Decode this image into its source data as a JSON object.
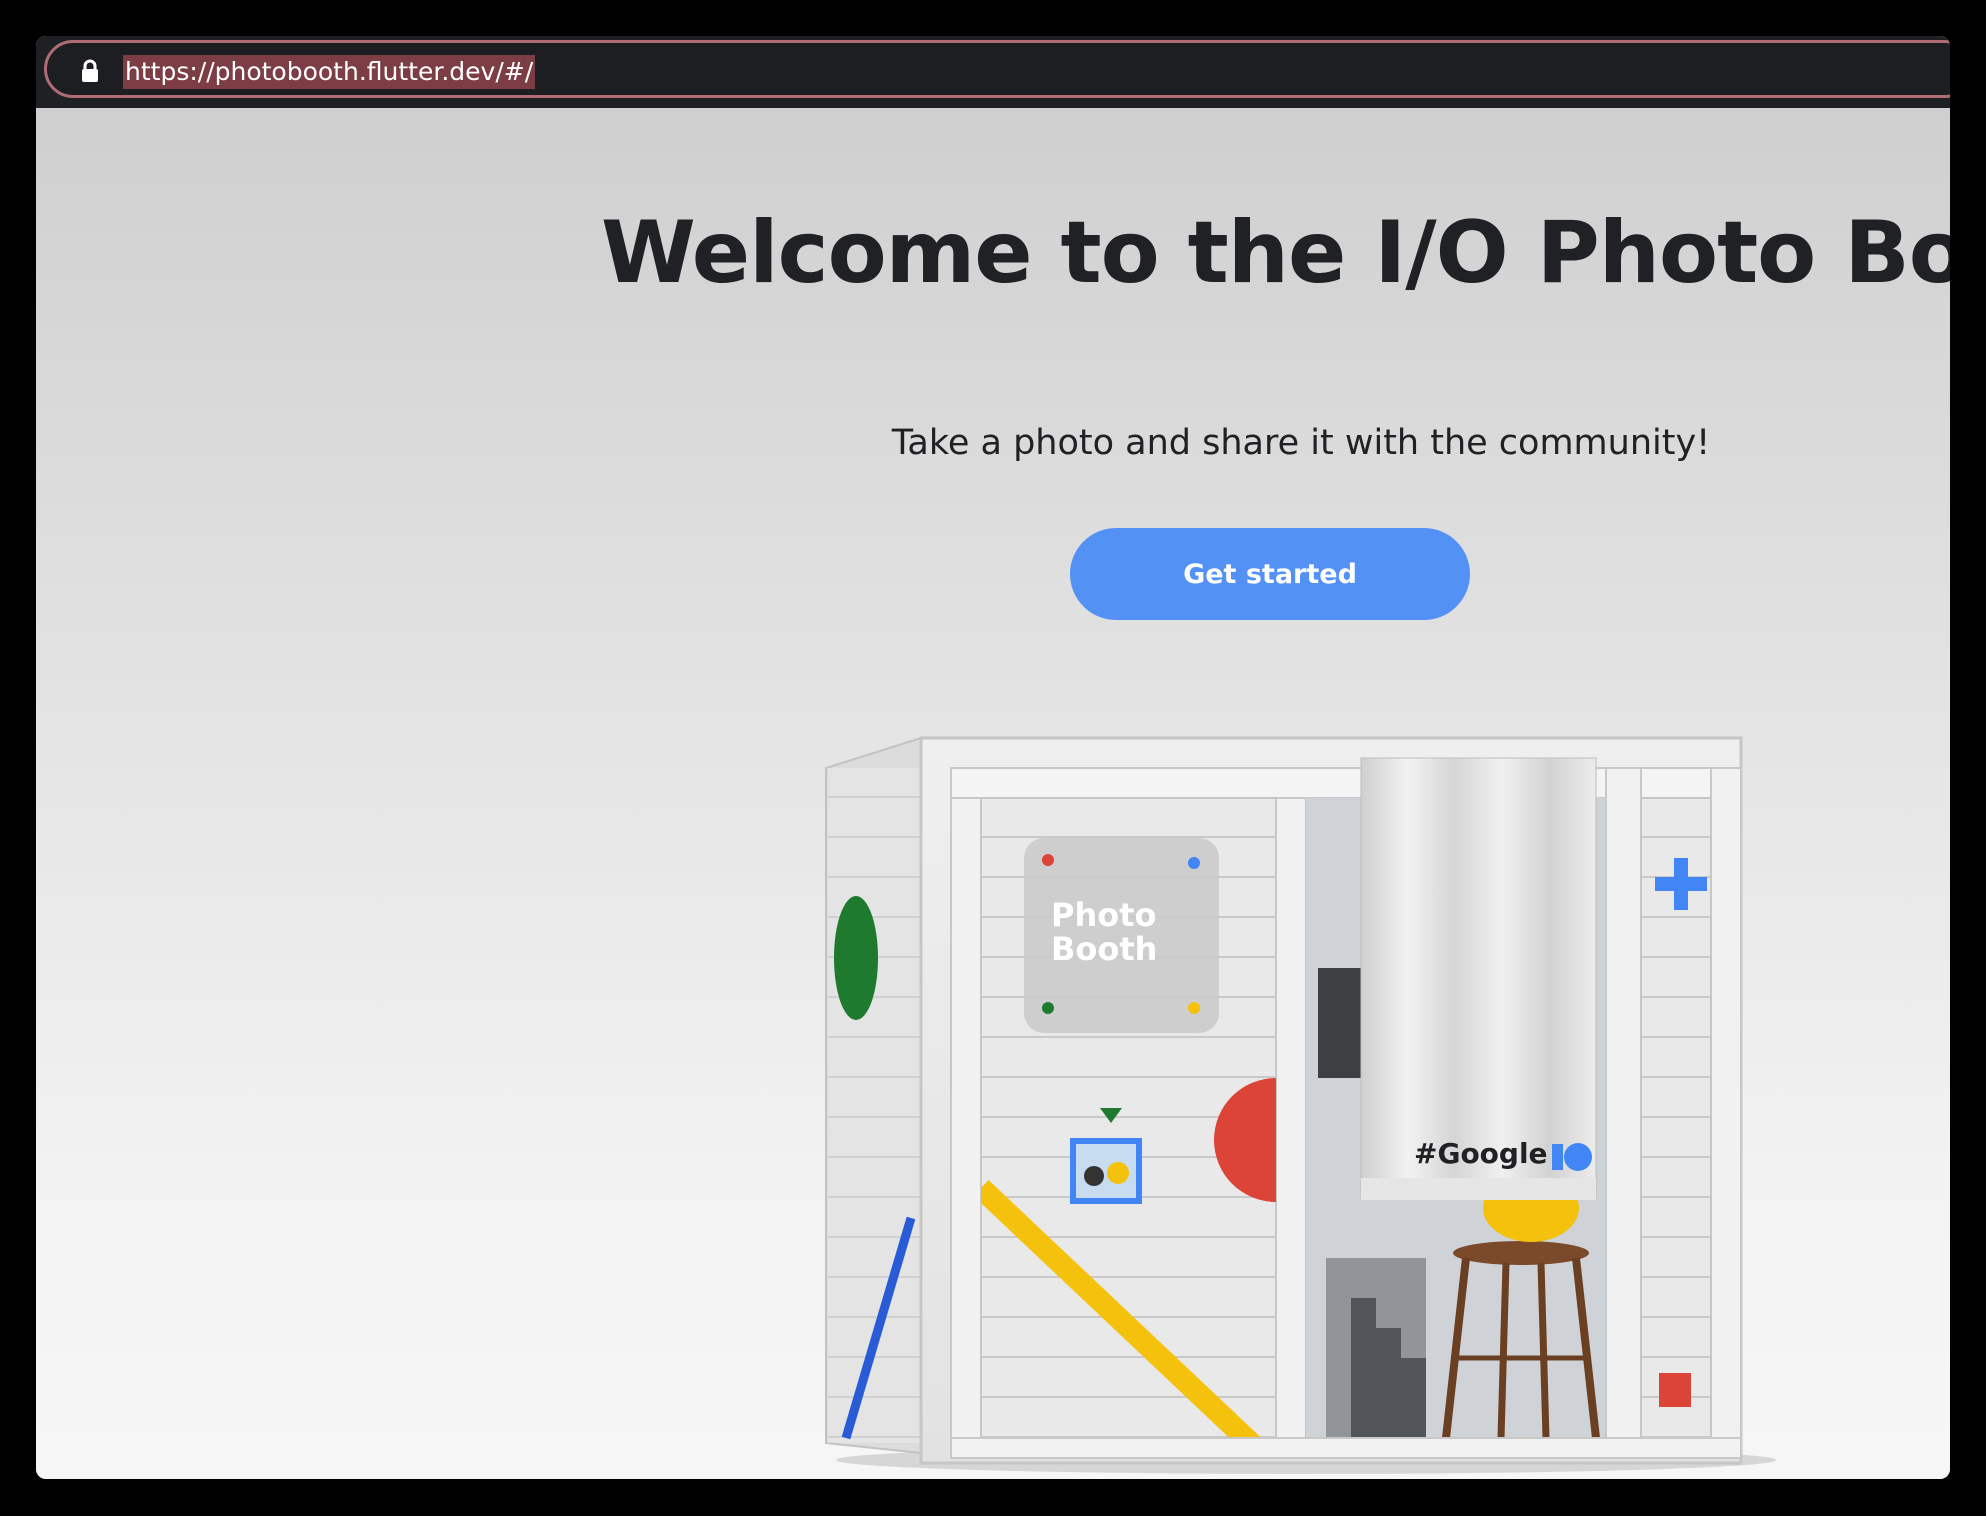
{
  "browser": {
    "url": "https://photobooth.flutter.dev/#/"
  },
  "hero": {
    "title": "Welcome to the I/O Photo Booth",
    "subtitle": "Take a photo and share it with the community!",
    "cta_label": "Get started"
  },
  "booth": {
    "sign_line1": "Photo",
    "sign_line2": "Booth",
    "hashtag": "#Google",
    "hashtag_mark": "IO"
  },
  "colors": {
    "button": "#5491f5",
    "google_blue": "#4285f4",
    "google_red": "#db4437",
    "google_yellow": "#f4c20d",
    "google_green": "#0f9d58",
    "title_text": "#202124"
  }
}
